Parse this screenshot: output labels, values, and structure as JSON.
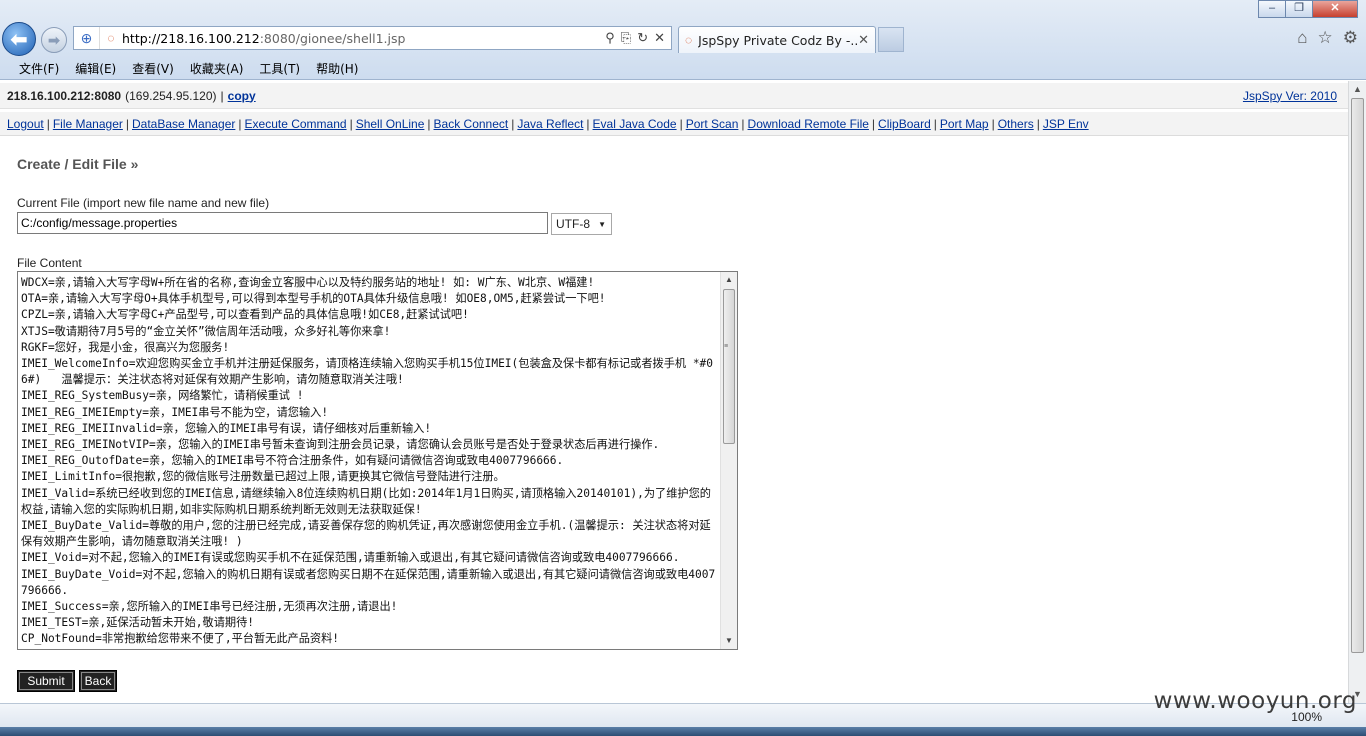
{
  "browser": {
    "url_host": "http://218.16.100.212",
    "url_rest": ":8080/gionee/shell1.jsp",
    "tab_title": "JspSpy Private Codz By -...",
    "menu": [
      "文件(F)",
      "编辑(E)",
      "查看(V)",
      "收藏夹(A)",
      "工具(T)",
      "帮助(H)"
    ],
    "zoom": "100%"
  },
  "info": {
    "host": "218.16.100.212:8080",
    "host_ip": "(169.254.95.120)",
    "separator": "|",
    "copy": "copy",
    "version": "JspSpy Ver: 2010"
  },
  "nav_links": [
    "Logout",
    "File Manager",
    "DataBase Manager",
    "Execute Command",
    "Shell OnLine",
    "Back Connect",
    "Java Reflect",
    "Eval Java Code",
    "Port Scan",
    "Download Remote File",
    "ClipBoard",
    "Port Map",
    "Others",
    "JSP Env"
  ],
  "editor": {
    "title": "Create / Edit File »",
    "current_file_label": "Current File (import new file name and new file)",
    "file_path": "C:/config/message.properties",
    "charset": "UTF-8",
    "content_label": "File Content",
    "content": "WDCX=亲,请输入大写字母W+所在省的名称,查询金立客服中心以及特约服务站的地址! 如: W广东、W北京、W福建!\nOTA=亲,请输入大写字母O+具体手机型号,可以得到本型号手机的OTA具体升级信息哦! 如OE8,OM5,赶紧尝试一下吧!\nCPZL=亲,请输入大写字母C+产品型号,可以查看到产品的具体信息哦!如CE8,赶紧试试吧!\nXTJS=敬请期待7月5号的“金立关怀”微信周年活动哦，众多好礼等你来拿!\nRGKF=您好，我是小金，很高兴为您服务!\nIMEI_WelcomeInfo=欢迎您购买金立手机并注册延保服务，请顶格连续输入您购买手机15位IMEI(包装盒及保卡都有标记或者拨手机 *#06#)   温馨提示：关注状态将对延保有效期产生影响，请勿随意取消关注哦!\nIMEI_REG_SystemBusy=亲，网络繁忙，请稍候重试 !\nIMEI_REG_IMEIEmpty=亲，IMEI串号不能为空，请您输入!\nIMEI_REG_IMEIInvalid=亲，您输入的IMEI串号有误，请仔细核对后重新输入!\nIMEI_REG_IMEINotVIP=亲，您输入的IMEI串号暂未查询到注册会员记录，请您确认会员账号是否处于登录状态后再进行操作.\nIMEI_REG_OutofDate=亲，您输入的IMEI串号不符合注册条件，如有疑问请微信咨询或致电4007796666.\nIMEI_LimitInfo=很抱歉,您的微信账号注册数量已超过上限,请更换其它微信号登陆进行注册。\nIMEI_Valid=系统已经收到您的IMEI信息,请继续输入8位连续购机日期(比如:2014年1月1日购买,请顶格输入20140101),为了维护您的权益,请输入您的实际购机日期,如非实际购机日期系统判断无效则无法获取延保!\nIMEI_BuyDate_Valid=尊敬的用户,您的注册已经完成,请妥善保存您的购机凭证,再次感谢您使用金立手机.(温馨提示: 关注状态将对延保有效期产生影响，请勿随意取消关注哦! )\nIMEI_Void=对不起,您输入的IMEI有误或您购买手机不在延保范围,请重新输入或退出,有其它疑问请微信咨询或致电4007796666.\nIMEI_BuyDate_Void=对不起,您输入的购机日期有误或者您购买日期不在延保范围,请重新输入或退出,有其它疑问请微信咨询或致电4007796666.\nIMEI_Success=亲,您所输入的IMEI串号已经注册,无须再次注册,请退出!\nIMEI_TEST=亲,延保活动暂未开始,敬请期待!\nCP_NotFound=非常抱歉给您带来不便了,平台暂无此产品资料!",
    "submit": "Submit",
    "back": "Back"
  },
  "watermark": "www.wooyun.org"
}
